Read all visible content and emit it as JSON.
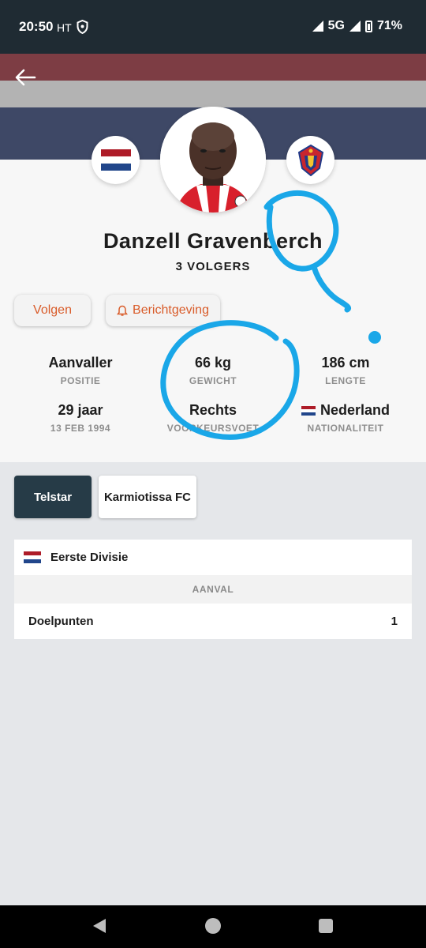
{
  "status_bar": {
    "time": "20:50",
    "carrier": "HT",
    "network": "5G",
    "battery": "71%"
  },
  "header": {
    "back_icon": "arrow-left-icon",
    "flag_colors": [
      "#7d3d44",
      "#b3b3b3",
      "#3e4866"
    ]
  },
  "player": {
    "name": "Danzell Gravenberch",
    "followers": "3 VOLGERS",
    "nationality_flag": [
      "#ae1c28",
      "#ffffff",
      "#21468b"
    ]
  },
  "actions": {
    "follow_label": "Volgen",
    "notify_label": "Berichtgeving",
    "notify_icon": "bell-icon",
    "accent_color": "#d95c2a"
  },
  "stats": [
    {
      "value": "Aanvaller",
      "label": "POSITIE"
    },
    {
      "value": "66 kg",
      "label": "GEWICHT"
    },
    {
      "value": "186 cm",
      "label": "LENGTE"
    },
    {
      "value": "29 jaar",
      "label": "13 FEB 1994"
    },
    {
      "value": "Rechts",
      "label": "VOORKEURSVOET"
    },
    {
      "value": "Nederland",
      "label": "NATIONALITEIT"
    }
  ],
  "clubs": {
    "active": "Telstar",
    "other": "Karmiotissa FC"
  },
  "competition": {
    "name": "Eerste Divisie",
    "section": "AANVAL",
    "rows": [
      {
        "label": "Doelpunten",
        "value": "1"
      }
    ]
  },
  "annotation_color": "#1aa7e8"
}
